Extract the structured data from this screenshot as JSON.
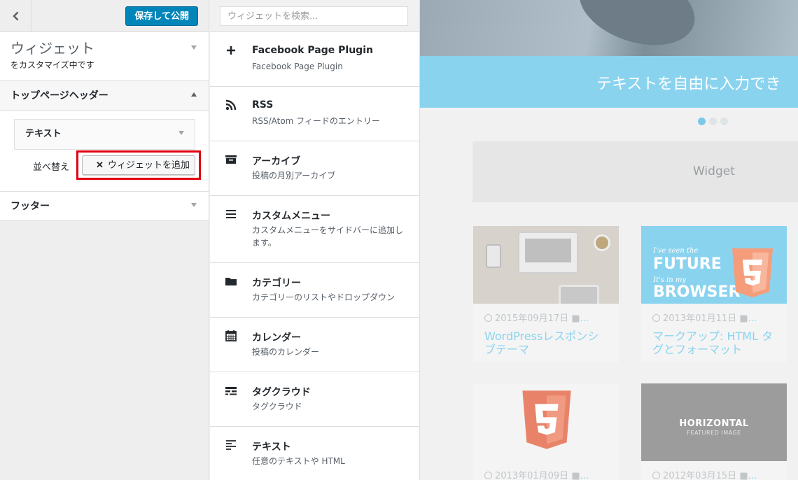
{
  "customizer": {
    "save_label": "保存して公開",
    "section_title": "ウィジェット",
    "section_subtitle": "をカスタマイズ中です",
    "area1_title": "トップページヘッダー",
    "widget_title": "テキスト",
    "reorder_label": "並べ替え",
    "add_widget_label": "ウィジェットを追加",
    "area2_title": "フッター"
  },
  "available": {
    "search_placeholder": "ウィジェットを検索...",
    "items": [
      {
        "title": "Facebook Page Plugin",
        "desc": "Facebook Page Plugin",
        "icon": "plus-icon"
      },
      {
        "title": "RSS",
        "desc": "RSS/Atom フィードのエントリー",
        "icon": "rss-icon"
      },
      {
        "title": "アーカイブ",
        "desc": "投稿の月別アーカイブ",
        "icon": "archive-icon"
      },
      {
        "title": "カスタムメニュー",
        "desc": "カスタムメニューをサイドバーに追加します。",
        "icon": "menu-icon"
      },
      {
        "title": "カテゴリー",
        "desc": "カテゴリーのリストやドロップダウン",
        "icon": "folder-icon"
      },
      {
        "title": "カレンダー",
        "desc": "投稿のカレンダー",
        "icon": "calendar-icon"
      },
      {
        "title": "タグクラウド",
        "desc": "タグクラウド",
        "icon": "tag-cloud-icon"
      },
      {
        "title": "テキスト",
        "desc": "任意のテキストや HTML",
        "icon": "text-icon"
      }
    ]
  },
  "preview": {
    "band_text": "テキストを自由に入力でき",
    "widget_label": "Widget",
    "cards": [
      {
        "date": "2015年09月17日",
        "title": "WordPressレスポンシブテーマ"
      },
      {
        "date": "2013年01月11日",
        "title": "マークアップ: HTML タグとフォーマット"
      },
      {
        "date": "2013年01月09日",
        "title": ""
      },
      {
        "date": "2012年03月15日",
        "title": ""
      }
    ],
    "thumb_html5": {
      "l1": "I've seen the",
      "l2": "FUTURE",
      "l3": "It's in my",
      "l4": "BROWSER"
    },
    "thumb_horizontal": {
      "l1": "HORIZONTAL",
      "l2": "FEATURED IMAGE"
    },
    "more": "..."
  },
  "colors": {
    "accent": "#0085ba",
    "highlight": "#e3000f",
    "preview_blue": "#8ad3ef"
  }
}
